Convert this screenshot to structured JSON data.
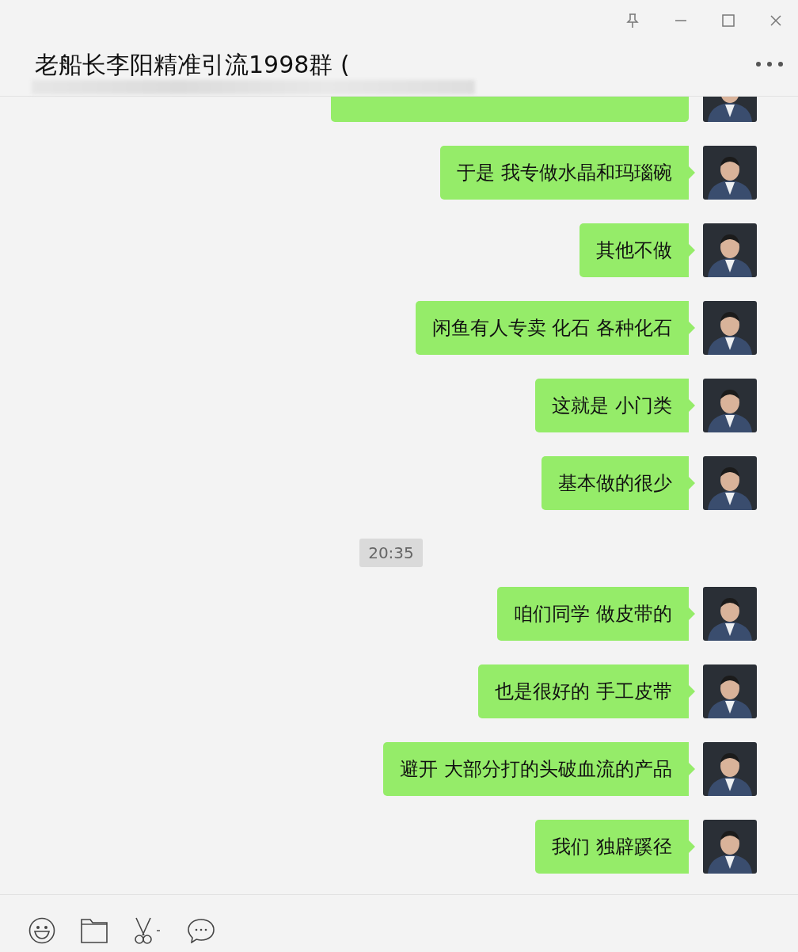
{
  "window": {
    "title": "老船长李阳精准引流1998群 ("
  },
  "messages": [
    {
      "kind": "partial"
    },
    {
      "kind": "text",
      "text": "于是 我专做水晶和玛瑙碗"
    },
    {
      "kind": "text",
      "text": "其他不做"
    },
    {
      "kind": "text",
      "text": "闲鱼有人专卖 化石 各种化石"
    },
    {
      "kind": "text",
      "text": "这就是 小门类"
    },
    {
      "kind": "text",
      "text": "基本做的很少"
    },
    {
      "kind": "time",
      "text": "20:35"
    },
    {
      "kind": "text",
      "text": "咱们同学 做皮带的"
    },
    {
      "kind": "text",
      "text": "也是很好的 手工皮带"
    },
    {
      "kind": "text",
      "text": "避开 大部分打的头破血流的产品"
    },
    {
      "kind": "text",
      "text": "我们 独辟蹊径"
    }
  ]
}
